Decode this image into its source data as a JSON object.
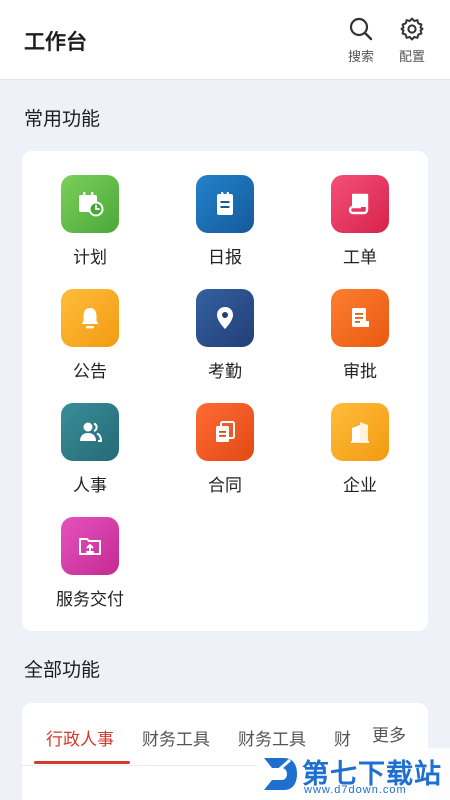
{
  "header": {
    "title": "工作台",
    "search_label": "搜索",
    "config_label": "配置"
  },
  "common": {
    "title": "常用功能",
    "items": [
      {
        "label": "计划",
        "icon": "calendar-clock-icon",
        "color": "#5db847"
      },
      {
        "label": "日报",
        "icon": "notepad-icon",
        "color": "#1a6fb5"
      },
      {
        "label": "工单",
        "icon": "scroll-icon",
        "color": "#e8345f"
      },
      {
        "label": "公告",
        "icon": "bell-icon",
        "color": "#f5a623"
      },
      {
        "label": "考勤",
        "icon": "location-pin-icon",
        "color": "#2b4f8f"
      },
      {
        "label": "审批",
        "icon": "document-icon",
        "color": "#f26b1d"
      },
      {
        "label": "人事",
        "icon": "people-icon",
        "color": "#2f7f8a"
      },
      {
        "label": "合同",
        "icon": "copy-icon",
        "color": "#f05a23"
      },
      {
        "label": "企业",
        "icon": "buildings-icon",
        "color": "#f5a623"
      },
      {
        "label": "服务交付",
        "icon": "folder-upload-icon",
        "color": "#d63ca8"
      }
    ]
  },
  "all": {
    "title": "全部功能",
    "tabs": [
      "行政人事",
      "财务工具",
      "财务工具",
      "财"
    ],
    "active_tab": 0,
    "more_label": "更多"
  },
  "watermark": {
    "title": "第七下载站",
    "url": "www.d7down.com"
  },
  "colors": {
    "accent": "#d33a2c",
    "background": "#eef1f7"
  }
}
